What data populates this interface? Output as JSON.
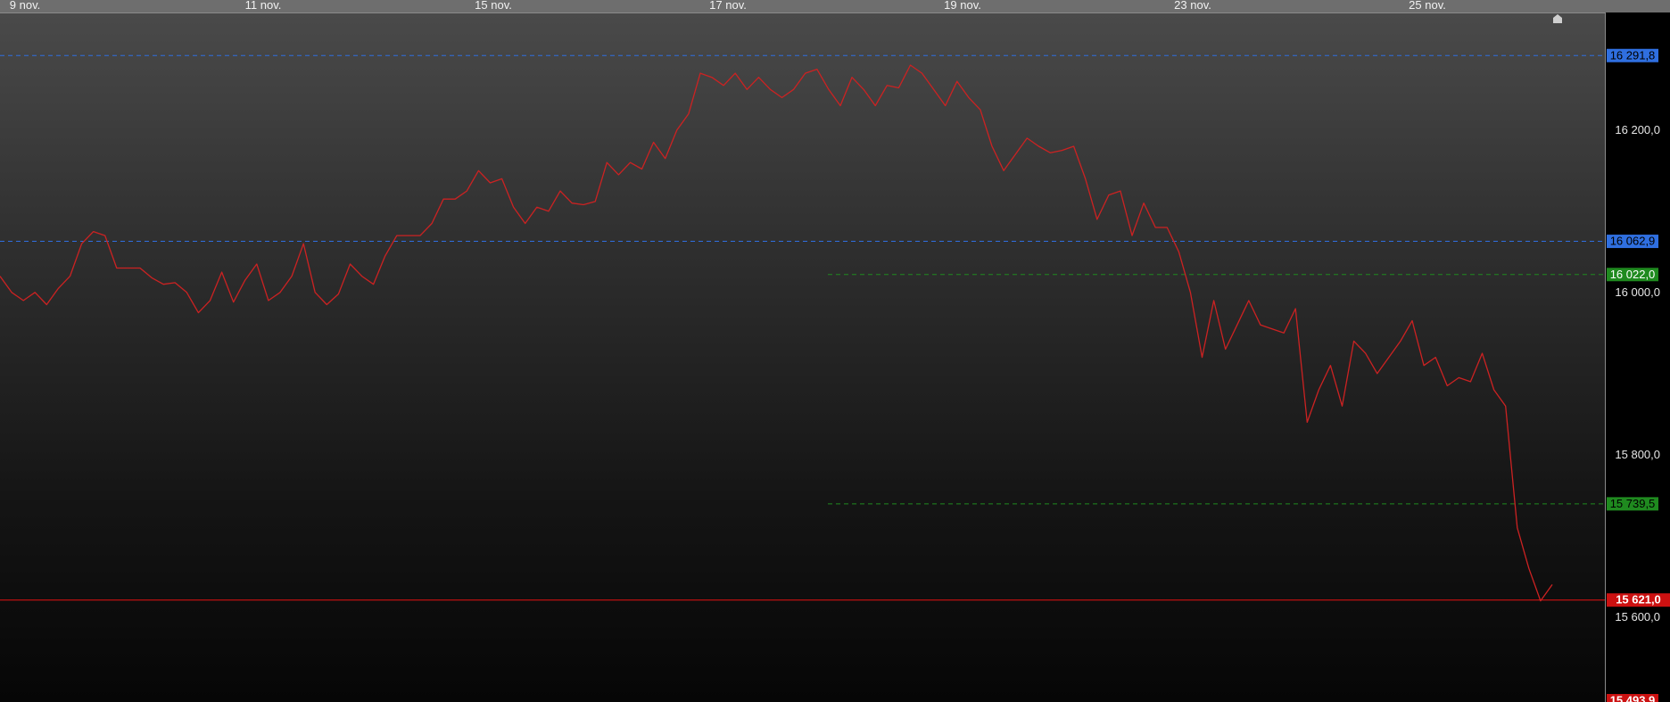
{
  "chart_data": {
    "type": "line",
    "x_tick_labels": [
      "9 nov.",
      "11 nov.",
      "15 nov.",
      "17 nov.",
      "19 nov.",
      "23 nov.",
      "25 nov."
    ],
    "y_tick_labels": [
      "16 200,0",
      "16 000,0",
      "15 800,0",
      "15 600,0"
    ],
    "y_tick_values": [
      16200,
      16000,
      15800,
      15600
    ],
    "ylim": [
      15480,
      16340
    ],
    "series": [
      {
        "color": "#cc2222",
        "values": [
          16020,
          16000,
          15990,
          16000,
          15985,
          16005,
          16020,
          16060,
          16075,
          16070,
          16030,
          16030,
          16030,
          16018,
          16010,
          16012,
          16000,
          15975,
          15990,
          16025,
          15988,
          16015,
          16035,
          15990,
          16000,
          16020,
          16060,
          16000,
          15985,
          15998,
          16035,
          16020,
          16010,
          16045,
          16070,
          16070,
          16070,
          16085,
          16115,
          16115,
          16125,
          16150,
          16135,
          16140,
          16105,
          16085,
          16105,
          16100,
          16125,
          16110,
          16108,
          16112,
          16160,
          16145,
          16160,
          16152,
          16185,
          16165,
          16200,
          16220,
          16270,
          16265,
          16255,
          16270,
          16250,
          16265,
          16250,
          16240,
          16250,
          16270,
          16275,
          16250,
          16230,
          16265,
          16250,
          16230,
          16255,
          16252,
          16280,
          16270,
          16250,
          16230,
          16260,
          16240,
          16225,
          16180,
          16150,
          16170,
          16190,
          16180,
          16172,
          16175,
          16180,
          16140,
          16090,
          16120,
          16125,
          16070,
          16110,
          16080,
          16080,
          16050,
          16000,
          15920,
          15990,
          15930,
          15960,
          15990,
          15960,
          15955,
          15950,
          15980,
          15840,
          15880,
          15910,
          15860,
          15940,
          15925,
          15900,
          15920,
          15940,
          15965,
          15910,
          15920,
          15885,
          15895,
          15890,
          15925,
          15880,
          15860,
          15710,
          15660,
          15620,
          15640
        ],
        "last": 15621
      }
    ],
    "reference_lines": [
      {
        "label": "16 291,8",
        "value": 16291.8,
        "color": "#2f6fe0",
        "text_color": "#000000",
        "style": "dashed",
        "span": "full"
      },
      {
        "label": "16 062,9",
        "value": 16062.9,
        "color": "#2f6fe0",
        "text_color": "#000000",
        "style": "dashed",
        "span": "full"
      },
      {
        "label": "16 022,0",
        "value": 16022.0,
        "color": "#1f8a1f",
        "text_color": "#ffffff",
        "style": "dashed",
        "span": "right"
      },
      {
        "label": "15 739,5",
        "value": 15739.5,
        "color": "#1f8a1f",
        "text_color": "#000000",
        "style": "dashed",
        "span": "right"
      },
      {
        "label": "15 621,0",
        "value": 15621.0,
        "color": "#cc1111",
        "text_color": "#ffffff",
        "style": "solid",
        "span": "full"
      },
      {
        "label": "15 493,9",
        "value": 15493.9,
        "color": "#cc1111",
        "text_color": "#ffffff",
        "style": "none",
        "span": "none"
      }
    ],
    "grid": false
  }
}
